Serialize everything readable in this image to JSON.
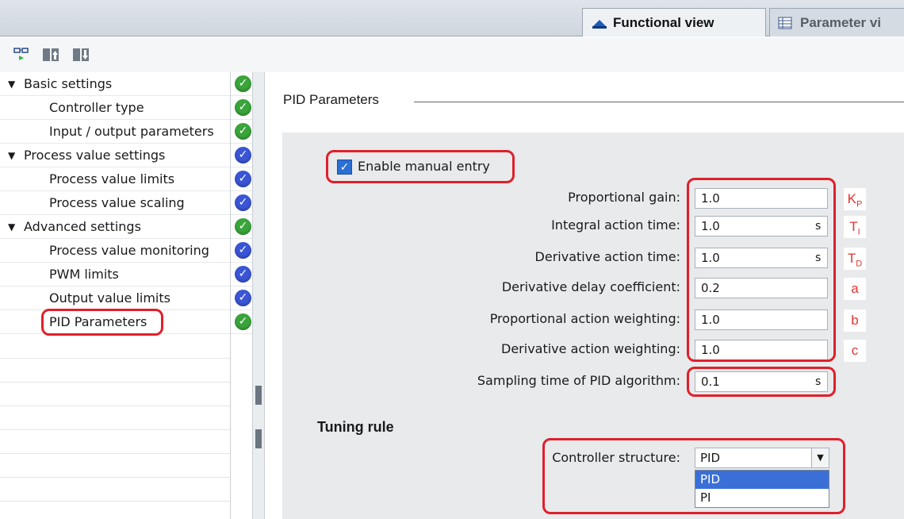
{
  "tabs": {
    "functional": "Functional view",
    "parameter": "Parameter vi"
  },
  "toolbar": {
    "icons": [
      "connect-icon",
      "expand-all-icon",
      "collapse-all-icon"
    ]
  },
  "tree": [
    {
      "label": "Basic settings",
      "level": 0,
      "expanded": true,
      "status": "green"
    },
    {
      "label": "Controller type",
      "level": 1,
      "status": "green"
    },
    {
      "label": "Input / output parameters",
      "level": 1,
      "status": "green"
    },
    {
      "label": "Process value settings",
      "level": 0,
      "expanded": true,
      "status": "blue"
    },
    {
      "label": "Process value limits",
      "level": 1,
      "status": "blue"
    },
    {
      "label": "Process value scaling",
      "level": 1,
      "status": "blue"
    },
    {
      "label": "Advanced settings",
      "level": 0,
      "expanded": true,
      "status": "green"
    },
    {
      "label": "Process value monitoring",
      "level": 1,
      "status": "blue"
    },
    {
      "label": "PWM limits",
      "level": 1,
      "status": "blue"
    },
    {
      "label": "Output value limits",
      "level": 1,
      "status": "blue"
    },
    {
      "label": "PID Parameters",
      "level": 1,
      "status": "green",
      "highlighted": true
    }
  ],
  "content": {
    "section_title": "PID Parameters",
    "enable_manual_entry": {
      "label": "Enable manual entry",
      "checked": true
    },
    "fields": [
      {
        "label": "Proportional gain:",
        "value": "1.0",
        "unit": "",
        "symbol": "K",
        "sub": "P"
      },
      {
        "label": "Integral action time:",
        "value": "1.0",
        "unit": "s",
        "symbol": "T",
        "sub": "I"
      },
      {
        "label": "Derivative action time:",
        "value": "1.0",
        "unit": "s",
        "symbol": "T",
        "sub": "D"
      },
      {
        "label": "Derivative delay coefficient:",
        "value": "0.2",
        "unit": "",
        "symbol": "a",
        "sub": ""
      },
      {
        "label": "Proportional action weighting:",
        "value": "1.0",
        "unit": "",
        "symbol": "b",
        "sub": ""
      },
      {
        "label": "Derivative action weighting:",
        "value": "1.0",
        "unit": "",
        "symbol": "c",
        "sub": ""
      },
      {
        "label": "Sampling time of PID algorithm:",
        "value": "0.1",
        "unit": "s",
        "symbol": "",
        "sub": ""
      }
    ],
    "tuning_rule": {
      "title": "Tuning rule",
      "controller_structure_label": "Controller structure:",
      "selected": "PID",
      "options": [
        "PID",
        "PI"
      ]
    }
  },
  "colors": {
    "highlight_red": "#e0202a",
    "status_green": "#3aa53a",
    "status_blue": "#3a55d6",
    "selection_blue": "#3a6fd8"
  }
}
